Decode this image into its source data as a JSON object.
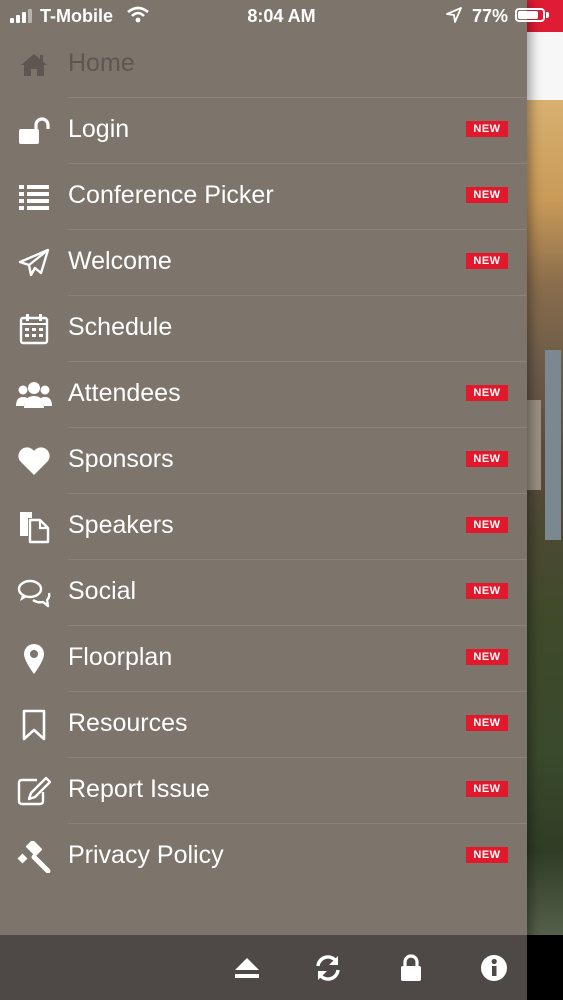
{
  "status_bar": {
    "carrier": "T-Mobile",
    "time": "8:04 AM",
    "battery": "77%",
    "battery_level": 0.77
  },
  "menu": {
    "items": [
      {
        "label": "Home",
        "icon": "home-icon",
        "badge": ""
      },
      {
        "label": "Login",
        "icon": "unlock-icon",
        "badge": "NEW"
      },
      {
        "label": "Conference Picker",
        "icon": "list-icon",
        "badge": "NEW"
      },
      {
        "label": "Welcome",
        "icon": "paper-plane-icon",
        "badge": "NEW"
      },
      {
        "label": "Schedule",
        "icon": "calendar-icon",
        "badge": ""
      },
      {
        "label": "Attendees",
        "icon": "users-icon",
        "badge": "NEW"
      },
      {
        "label": "Sponsors",
        "icon": "heart-icon",
        "badge": "NEW"
      },
      {
        "label": "Speakers",
        "icon": "documents-icon",
        "badge": "NEW"
      },
      {
        "label": "Social",
        "icon": "chat-bubbles-icon",
        "badge": "NEW"
      },
      {
        "label": "Floorplan",
        "icon": "map-pin-icon",
        "badge": "NEW"
      },
      {
        "label": "Resources",
        "icon": "bookmark-icon",
        "badge": "NEW"
      },
      {
        "label": "Report Issue",
        "icon": "edit-icon",
        "badge": "NEW"
      },
      {
        "label": "Privacy Policy",
        "icon": "gavel-icon",
        "badge": "NEW"
      }
    ]
  },
  "bottom_bar": {
    "buttons": [
      "eject-icon",
      "refresh-icon",
      "lock-icon",
      "info-icon"
    ]
  },
  "colors": {
    "drawer_bg": "#7d746c",
    "badge_red": "#e2182d",
    "bottom_bar_bg": "#4e4946",
    "home_label": "#5e5650"
  }
}
